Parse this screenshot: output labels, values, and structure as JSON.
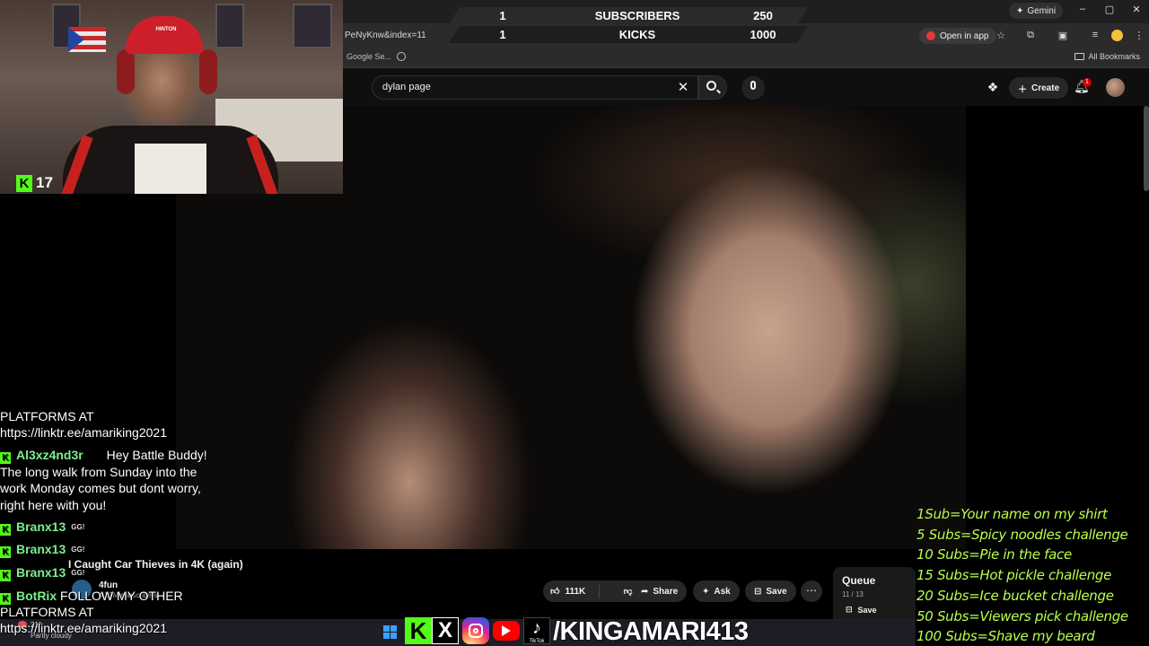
{
  "goal_overlay": {
    "rows": [
      {
        "current": "1",
        "label": "SUBSCRIBERS",
        "target": "250"
      },
      {
        "current": "1",
        "label": "KICKS",
        "target": "1000"
      }
    ]
  },
  "browser": {
    "url_fragment": "PeNyKnw&index=11",
    "gemini_label": "Gemini",
    "open_in_app_label": "Open in app",
    "bookmark_item": "Google Se...",
    "all_bookmarks_label": "All Bookmarks",
    "window_controls": {
      "minimize": "–",
      "restore": "▢",
      "close": "✕"
    }
  },
  "youtube": {
    "search_value": "dylan page",
    "create_label": "Create",
    "notification_count": "1",
    "video_title": "I Caught Car Thieves in 4K (again)",
    "channel_name": "4fun",
    "channel_subs": "4.23M subscribers",
    "like_count": "111K",
    "share_label": "Share",
    "ask_label": "Ask",
    "save_label": "Save",
    "more_label": "⋯",
    "queue": {
      "title": "Queue",
      "count": "11 / 13",
      "save_label": "Save"
    }
  },
  "webcam": {
    "hat_text": "HINTON",
    "kick_viewers": "17"
  },
  "chat": [
    {
      "user": "",
      "text": "PLATFORMS AT"
    },
    {
      "user": "",
      "text": "https://linktr.ee/amariking2021"
    },
    {
      "user": "Al3xz4nd3r",
      "text": "Hey Battle Buddy!"
    },
    {
      "user": "",
      "text": "The long walk from Sunday into the"
    },
    {
      "user": "",
      "text": "work Monday comes but dont worry,"
    },
    {
      "user": "",
      "text": "right here with you!"
    },
    {
      "user": "Branx13",
      "text": "GG!"
    },
    {
      "user": "Branx13",
      "text": "GG!"
    },
    {
      "user": "Branx13",
      "text": "GG!"
    },
    {
      "user": "BotRix",
      "text": "FOLLOW MY OTHER"
    },
    {
      "user": "",
      "text": "PLATFORMS AT"
    },
    {
      "user": "",
      "text": "https://linktr.ee/amariking2021"
    }
  ],
  "rewards": [
    "1Sub=Your name on my shirt",
    "5 Subs=Spicy noodles challenge",
    "10 Subs=Pie in the face",
    "15 Subs=Hot pickle challenge",
    "20 Subs=Ice bucket challenge",
    "50 Subs=Viewers pick challenge",
    "100 Subs=Shave my beard"
  ],
  "taskbar": {
    "weather_temp": "21°",
    "weather_text": "Partly cloudy",
    "social_handle": "/KINGAMARI413",
    "tiktok_label": "TikTok"
  },
  "colors": {
    "kick_green": "#53fc18",
    "reward_text": "#b9ff4a",
    "chat_user": "#7bf08c",
    "youtube_red": "#ff0000"
  }
}
